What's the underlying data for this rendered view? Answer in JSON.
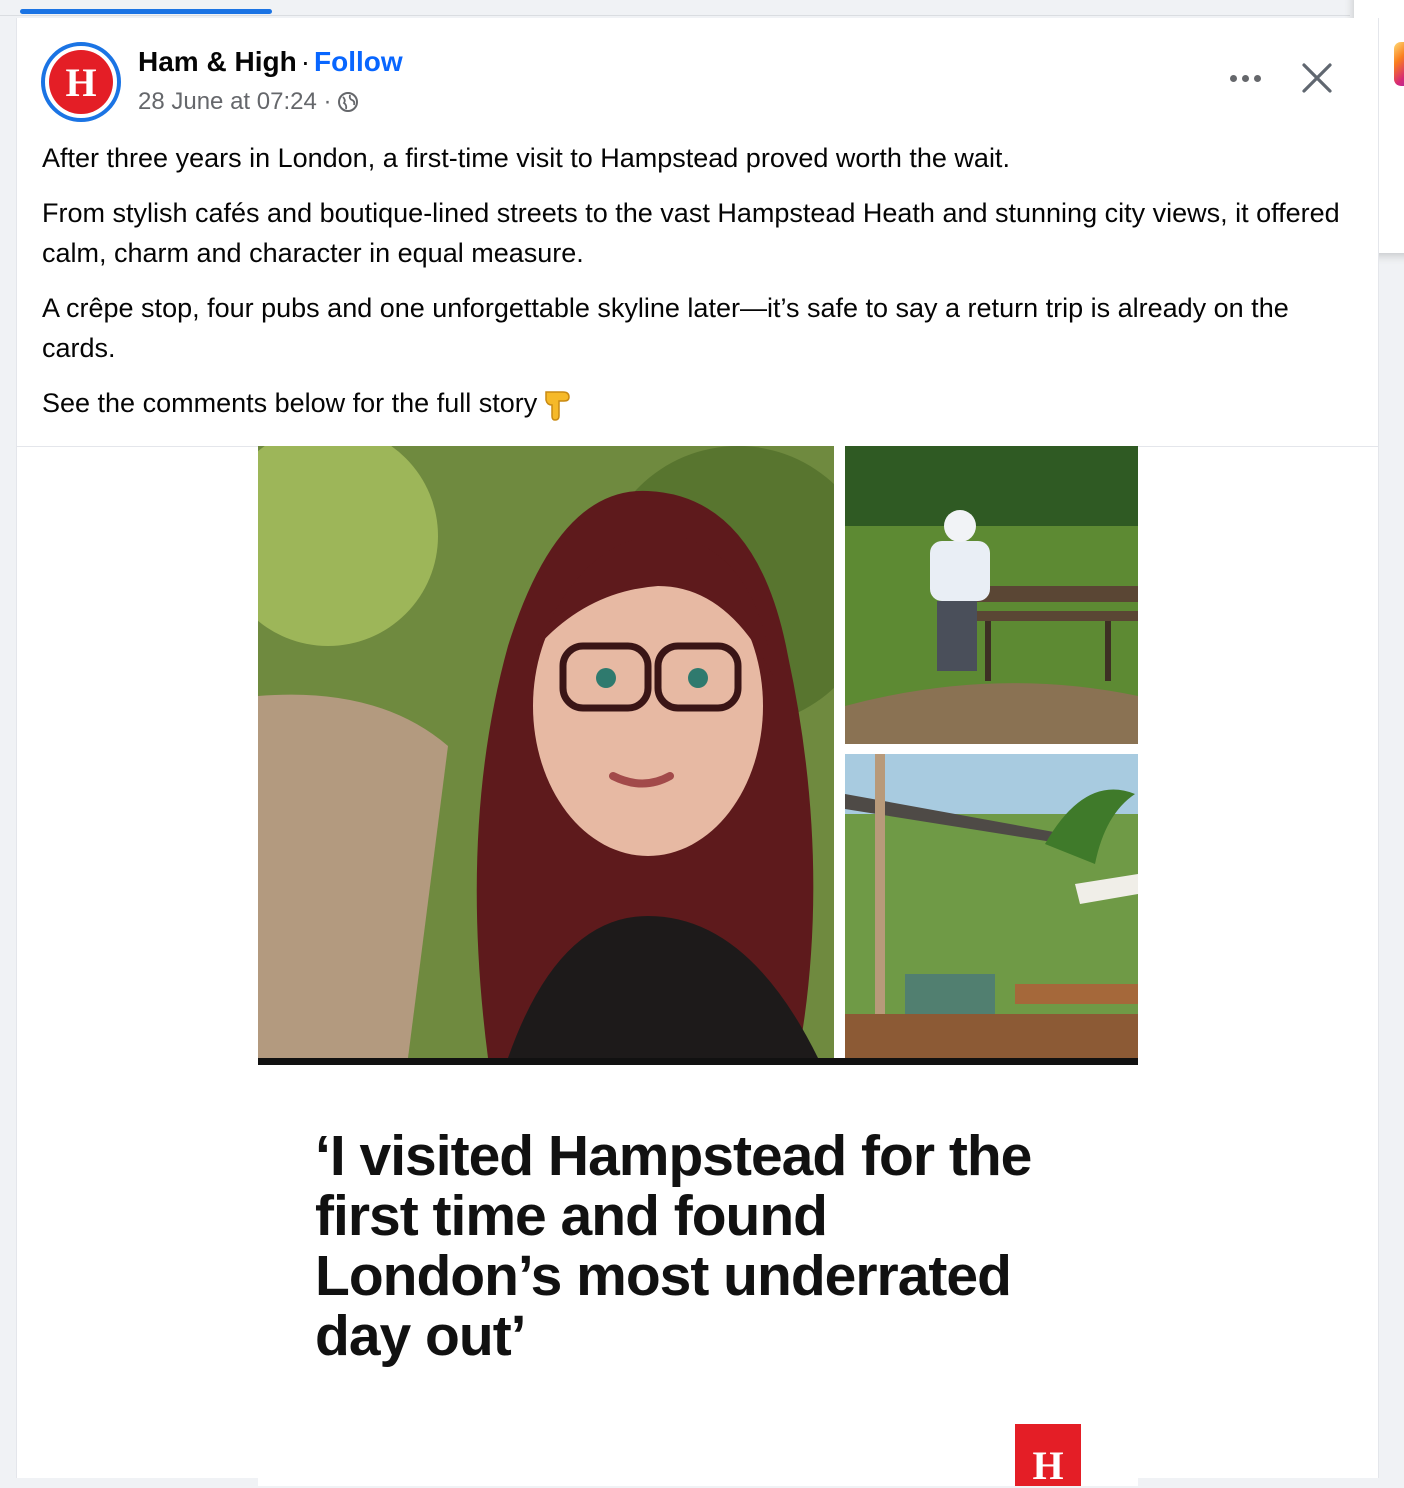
{
  "post": {
    "author": {
      "name": "Ham & High",
      "separator": "·",
      "follow_label": "Follow",
      "avatar_letter": "H"
    },
    "timestamp": "28 June at 07:24 ·",
    "caption": [
      "After three years in London, a first-time visit to Hampstead proved worth the wait.",
      "From stylish cafés and boutique-lined streets to the vast Hampstead Heath and stunning city views, it offered calm, charm and character in equal measure.",
      "A crêpe stop, four pubs and one unforgettable skyline later—it’s safe to say a return trip is already on the cards.",
      "See the comments below for the full story"
    ],
    "media": {
      "headline": "‘I visited Hampstead for the first time and found London’s most underrated day out’",
      "brand_logo_letter": "H"
    }
  },
  "colors": {
    "accent": "#1b74e4",
    "follow": "#0866ff",
    "brand_red": "#e41e26",
    "muted": "#65676b"
  },
  "icons": [
    "globe-icon",
    "more-options-icon",
    "close-icon",
    "pointing-down-emoji"
  ]
}
